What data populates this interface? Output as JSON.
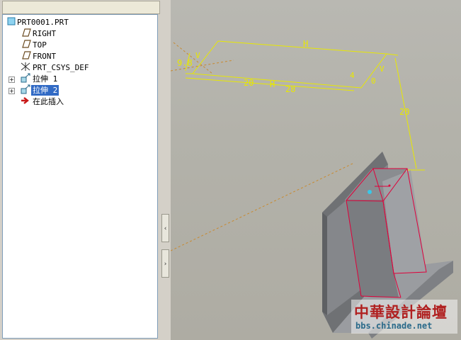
{
  "model_tree": {
    "items": [
      {
        "label": "PRT0001.PRT",
        "icon": "part-icon",
        "level": 0,
        "expandable": false,
        "selected": false
      },
      {
        "label": "RIGHT",
        "icon": "datum-plane-icon",
        "level": 1,
        "expandable": false,
        "selected": false
      },
      {
        "label": "TOP",
        "icon": "datum-plane-icon",
        "level": 1,
        "expandable": false,
        "selected": false
      },
      {
        "label": "FRONT",
        "icon": "datum-plane-icon",
        "level": 1,
        "expandable": false,
        "selected": false
      },
      {
        "label": "PRT_CSYS_DEF",
        "icon": "coordinate-system-icon",
        "level": 1,
        "expandable": false,
        "selected": false
      },
      {
        "label": "拉伸 1",
        "icon": "extrude-icon",
        "level": 1,
        "expandable": true,
        "selected": false
      },
      {
        "label": "拉伸 2",
        "icon": "extrude-icon",
        "level": 1,
        "expandable": true,
        "selected": true
      },
      {
        "label": "在此插入",
        "icon": "insert-here-arrow-icon",
        "level": 1,
        "expandable": false,
        "selected": false
      }
    ]
  },
  "splitter": {
    "collapse_glyph": "‹",
    "expand_glyph": "›"
  },
  "dimensions": {
    "h_top": "H",
    "left_98": "9.8",
    "v_left": "V",
    "bottom_20": "20",
    "bottom_h": "H",
    "bottom_28": "28",
    "right_4": "4",
    "right_v": "V",
    "right_0": "0",
    "vertical_20": "20"
  },
  "watermark": {
    "text": "中華設計論壇",
    "url": "bbs.chinade.net"
  },
  "colors": {
    "sketch_yellow": "#e8e800",
    "datum_orange": "#c88a30",
    "edge_red": "#e0003a",
    "body_gray": "#8a8c90",
    "selection_blue": "#316ac5"
  }
}
